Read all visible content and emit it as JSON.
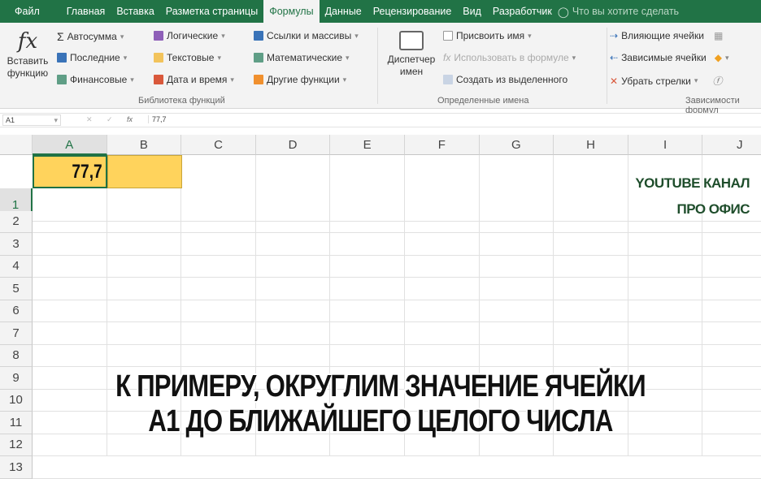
{
  "tabs": [
    "Файл",
    "Главная",
    "Вставка",
    "Разметка страницы",
    "Формулы",
    "Данные",
    "Рецензирование",
    "Вид",
    "Разработчик"
  ],
  "tell_me": "Что вы хотите сделать",
  "ribbon": {
    "insert_function": [
      "Вставить",
      "функцию"
    ],
    "lib": [
      "Автосумма",
      "Последние",
      "Финансовые",
      "Логические",
      "Текстовые",
      "Дата и время",
      "Ссылки и массивы",
      "Математические",
      "Другие функции"
    ],
    "lib_label": "Библиотека функций",
    "name_manager": [
      "Диспетчер",
      "имен"
    ],
    "names": [
      "Присвоить имя",
      "Использовать в формуле",
      "Создать из выделенного"
    ],
    "names_label": "Определенные имена",
    "deps": [
      "Влияющие ячейки",
      "Зависимые ячейки",
      "Убрать стрелки"
    ],
    "deps_label": "Зависимости формул"
  },
  "formula_bar": {
    "name_box": "A1",
    "value": "77,7"
  },
  "columns": [
    "A",
    "B",
    "C",
    "D",
    "E",
    "F",
    "G",
    "H",
    "I",
    "J"
  ],
  "rows": [
    "1",
    "2",
    "3",
    "4",
    "5",
    "6",
    "7",
    "8",
    "9",
    "10",
    "11",
    "12",
    "13"
  ],
  "cell_a1": "77,7",
  "watermark": [
    "YOUTUBE КАНАЛ",
    "ПРО ОФИС"
  ],
  "caption": [
    "К ПРИМЕРУ, ОКРУГЛИМ ЗНАЧЕНИЕ ЯЧЕЙКИ",
    "А1 ДО БЛИЖАЙШЕГО ЦЕЛОГО ЧИСЛА"
  ],
  "colors": {
    "accent": "#217346",
    "selection": "#ffd35c"
  }
}
